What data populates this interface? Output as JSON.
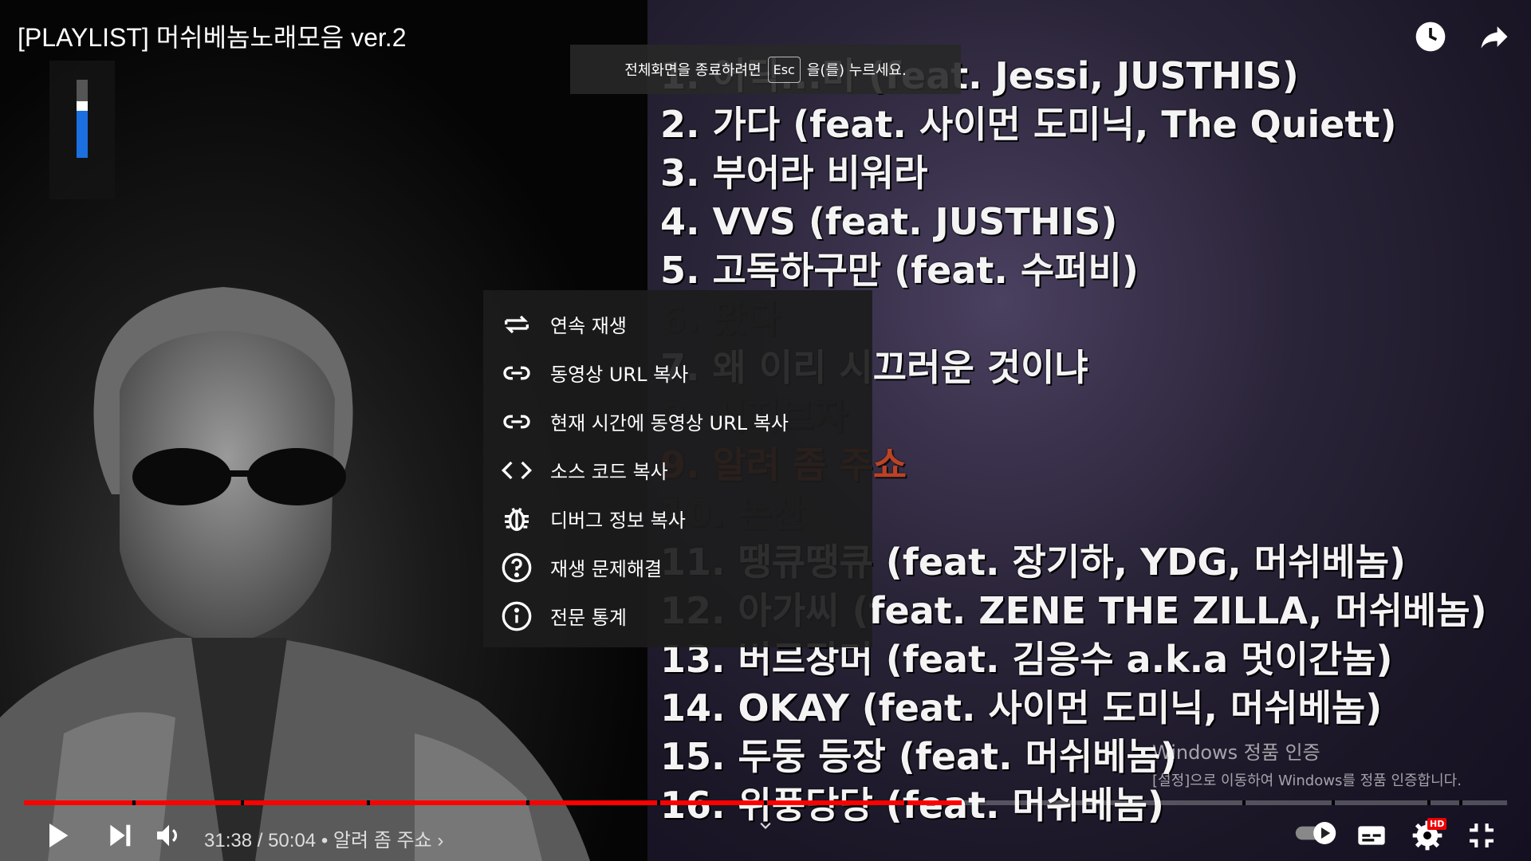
{
  "video": {
    "title": "[PLAYLIST] 머쉬베놈노래모음 ver.2",
    "tracks": [
      {
        "text": "1. 어딕...미 (feat. Jessi, JUSTHIS)",
        "state": "normal"
      },
      {
        "text": "2. 가다 (feat. 사이먼 도미닉, The Quiett)",
        "state": "normal"
      },
      {
        "text": "3. 부어라 비워라",
        "state": "normal"
      },
      {
        "text": "4. VVS (feat. JUSTHIS)",
        "state": "normal"
      },
      {
        "text": "5. 고독하구만 (feat. 수퍼비)",
        "state": "normal"
      },
      {
        "text": "6. 왔다",
        "state": "dim"
      },
      {
        "text": "7. 왜 이리 시끄러운 것이냐",
        "state": "normal"
      },
      {
        "text": "8. 시지브자",
        "state": "dim"
      },
      {
        "text": "9. 알려 좀 주쇼",
        "state": "highlight"
      },
      {
        "text": "10. 논산",
        "state": "dim"
      },
      {
        "text": "11. 땡큐땡큐 (feat. 장기하, YDG, 머쉬베놈)",
        "state": "normal"
      },
      {
        "text": "12. 아가씨 (feat. ZENE THE ZILLA, 머쉬베놈)",
        "state": "normal"
      },
      {
        "text": "13. 버르장머 (feat. 김응수 a.k.a 멋이간놈)",
        "state": "normal"
      },
      {
        "text": "14. OKAY (feat. 사이먼 도미닉, 머쉬베놈)",
        "state": "normal"
      },
      {
        "text": "15. 두둥 등장 (feat. 머쉬베놈)",
        "state": "normal"
      },
      {
        "text": "16. 위풍당당 (feat. 머쉬베놈)",
        "state": "normal"
      }
    ]
  },
  "toast": {
    "before": "전체화면을 종료하려면",
    "key": "Esc",
    "after": "을(를) 누르세요."
  },
  "volume": {
    "level": 0.6
  },
  "context_menu": {
    "items": [
      {
        "label": "연속 재생",
        "icon": "loop-icon"
      },
      {
        "label": "동영상 URL 복사",
        "icon": "link-icon"
      },
      {
        "label": "현재 시간에 동영상 URL 복사",
        "icon": "link-icon"
      },
      {
        "label": "소스 코드 복사",
        "icon": "code-icon"
      },
      {
        "label": "디버그 정보 복사",
        "icon": "bug-icon"
      },
      {
        "label": "재생 문제해결",
        "icon": "help-circle-icon"
      },
      {
        "label": "전문 통계",
        "icon": "info-circle-icon"
      }
    ]
  },
  "watermark": {
    "line1": "Windows 정품 인증",
    "line2": "[설정]으로 이동하여 Windows를 정품 인증합니다."
  },
  "player": {
    "time_current": "31:38",
    "time_total": "50:04",
    "chapter": "알려 좀 주쇼",
    "progress": 0.632,
    "hd_badge": "HD",
    "colors": {
      "progress": "#ff0000",
      "accent": "#1c6fe0",
      "highlight_track": "#e84a1a"
    }
  }
}
